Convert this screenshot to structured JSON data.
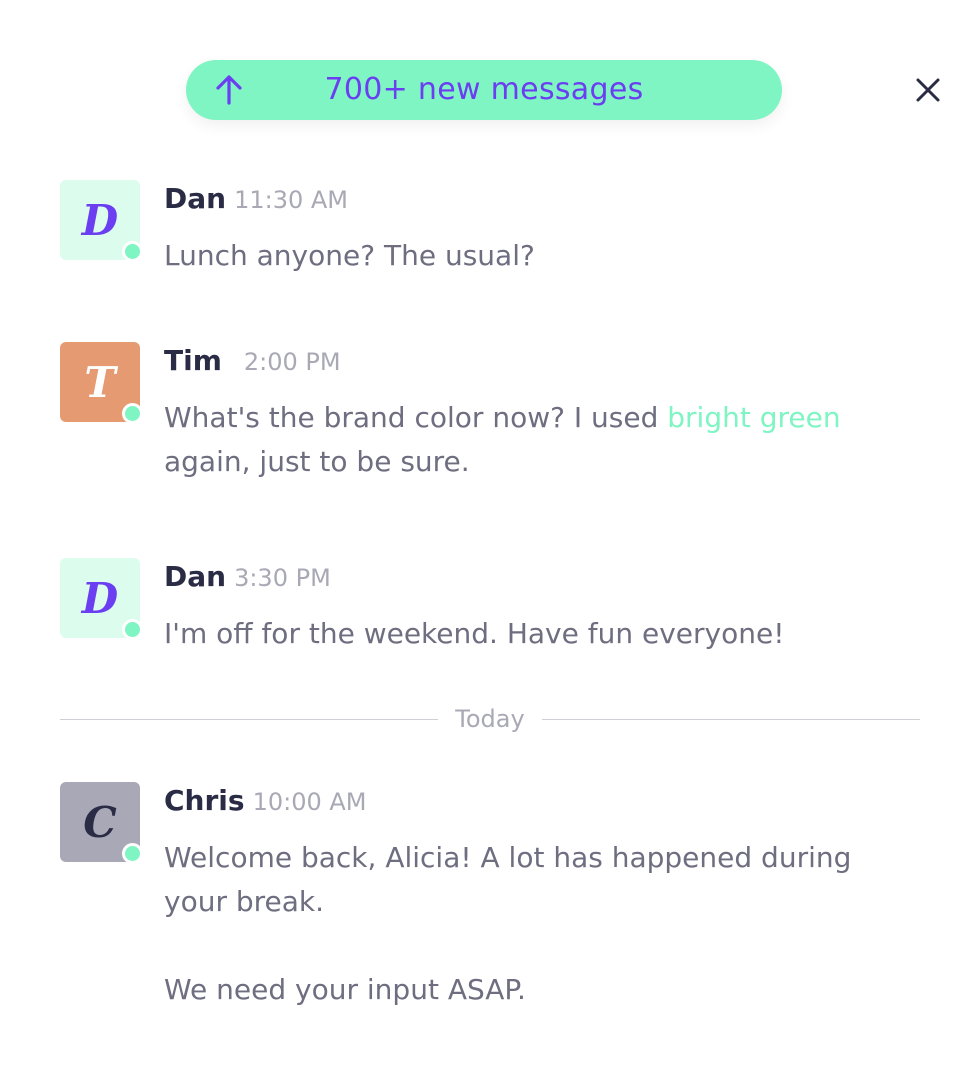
{
  "banner": {
    "label": "700+ new messages",
    "up_icon": "arrow-up-icon",
    "close_icon": "close-icon"
  },
  "colors": {
    "accent_green": "#7ff5c3",
    "accent_purple": "#6b3ef2",
    "tim_avatar": "#e59a72",
    "chris_avatar": "#a8a8b6",
    "dan_avatar": "#dcfdee"
  },
  "messages": [
    {
      "author": "Dan",
      "initial": "D",
      "time": "11:30 AM",
      "text": "Lunch anyone? The usual?"
    },
    {
      "author": "Tim",
      "initial": "T",
      "time": "2:00 PM",
      "text_before": "What's the brand color now? I used ",
      "highlight": "bright green",
      "text_after": " again, just to be sure."
    },
    {
      "author": "Dan",
      "initial": "D",
      "time": "3:30 PM",
      "text": "I'm off for the weekend. Have fun everyone!"
    },
    {
      "author": "Chris",
      "initial": "C",
      "time": "10:00 AM",
      "paragraphs": [
        "Welcome back, Alicia! A lot has happened during your break.",
        "We need your input ASAP."
      ]
    }
  ],
  "divider": {
    "label": "Today"
  }
}
